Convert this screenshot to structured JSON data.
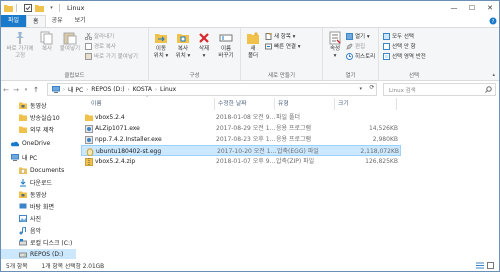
{
  "window": {
    "title": "Linux",
    "controls": {
      "minimize": "—",
      "maximize": "☐",
      "close": "✕"
    }
  },
  "tabs": [
    {
      "label": "파일"
    },
    {
      "label": "홈"
    },
    {
      "label": "공유"
    },
    {
      "label": "보기"
    }
  ],
  "ribbon": {
    "clipboard": {
      "group_label": "클립보드",
      "pin": "바로 가기에\n고정",
      "copy": "복사",
      "paste": "붙여넣기",
      "cut": "잘라내기",
      "copy_path": "경로 복사",
      "paste_shortcut": "바로 가기 붙여넣기"
    },
    "organize": {
      "group_label": "구성",
      "move_to": "이동\n위치 ▾",
      "copy_to": "복사\n위치 ▾",
      "delete": "삭제\n▾",
      "rename": "이름\n바꾸기"
    },
    "new": {
      "group_label": "새로 만들기",
      "new_folder": "새\n폴더",
      "new_item": "새 항목 ▾",
      "easy_access": "빠른 연결 ▾"
    },
    "open": {
      "group_label": "열기",
      "properties": "속성\n▾",
      "open": "열기 ▾",
      "edit": "편집",
      "history": "히스토리"
    },
    "select": {
      "group_label": "선택",
      "select_all": "모두 선택",
      "select_none": "선택 안 함",
      "invert": "선택 영역 반전"
    }
  },
  "address": {
    "crumbs": [
      "내 PC",
      "REPOS (D:)",
      "KOSTA",
      "Linux"
    ],
    "search_placeholder": "Linux 검색"
  },
  "nav": {
    "items": [
      {
        "label": "동영상",
        "icon": "video-folder-icon",
        "indent": 1
      },
      {
        "label": "방송실습10",
        "icon": "folder-icon",
        "indent": 1
      },
      {
        "label": "외부 제작",
        "icon": "folder-icon",
        "indent": 1
      },
      {
        "label": "OneDrive",
        "icon": "onedrive-icon",
        "indent": 0
      },
      {
        "label": "내 PC",
        "icon": "pc-icon",
        "indent": 0
      },
      {
        "label": "Documents",
        "icon": "documents-icon",
        "indent": 1
      },
      {
        "label": "다운로드",
        "icon": "downloads-icon",
        "indent": 1
      },
      {
        "label": "동영상",
        "icon": "video-folder-icon",
        "indent": 1
      },
      {
        "label": "바탕 화면",
        "icon": "desktop-icon",
        "indent": 1
      },
      {
        "label": "사진",
        "icon": "pictures-icon",
        "indent": 1
      },
      {
        "label": "음악",
        "icon": "music-icon",
        "indent": 1
      },
      {
        "label": "로컬 디스크 (C:)",
        "icon": "drive-c-icon",
        "indent": 1
      },
      {
        "label": "REPOS (D:)",
        "icon": "drive-d-icon",
        "indent": 1,
        "selected": true
      }
    ]
  },
  "columns": {
    "name": "이름",
    "date": "수정한 날짜",
    "type": "유형",
    "size": "크기"
  },
  "files": [
    {
      "name": "vbox5.2.4",
      "date": "2018-01-08 오전 9...",
      "type": "파일 폴더",
      "size": "",
      "icon": "folder-icon"
    },
    {
      "name": "ALZip1071.exe",
      "date": "2017-08-29 오전 1...",
      "type": "응용 프로그램",
      "size": "14,526KB",
      "icon": "exe-icon"
    },
    {
      "name": "npp.7.4.2.Installer.exe",
      "date": "2017-08-23 오후 1...",
      "type": "응용 프로그램",
      "size": "2,980KB",
      "icon": "exe-icon"
    },
    {
      "name": "ubuntu180402-st.egg",
      "date": "2017-10-20 오전 1...",
      "type": "압축(EGG) 파일",
      "size": "2,118,072KB",
      "icon": "egg-icon",
      "selected": true
    },
    {
      "name": "vbox5.2.4.zip",
      "date": "2018-01-07 오후 9...",
      "type": "압축(ZIP) 파일",
      "size": "126,825KB",
      "icon": "zip-icon"
    }
  ],
  "status": {
    "count": "5개 항목",
    "selection": "1개 항목 선택함 2.01GB"
  },
  "colors": {
    "accent": "#1979ca",
    "selection": "#cce8ff",
    "selection_border": "#99d1ff"
  }
}
